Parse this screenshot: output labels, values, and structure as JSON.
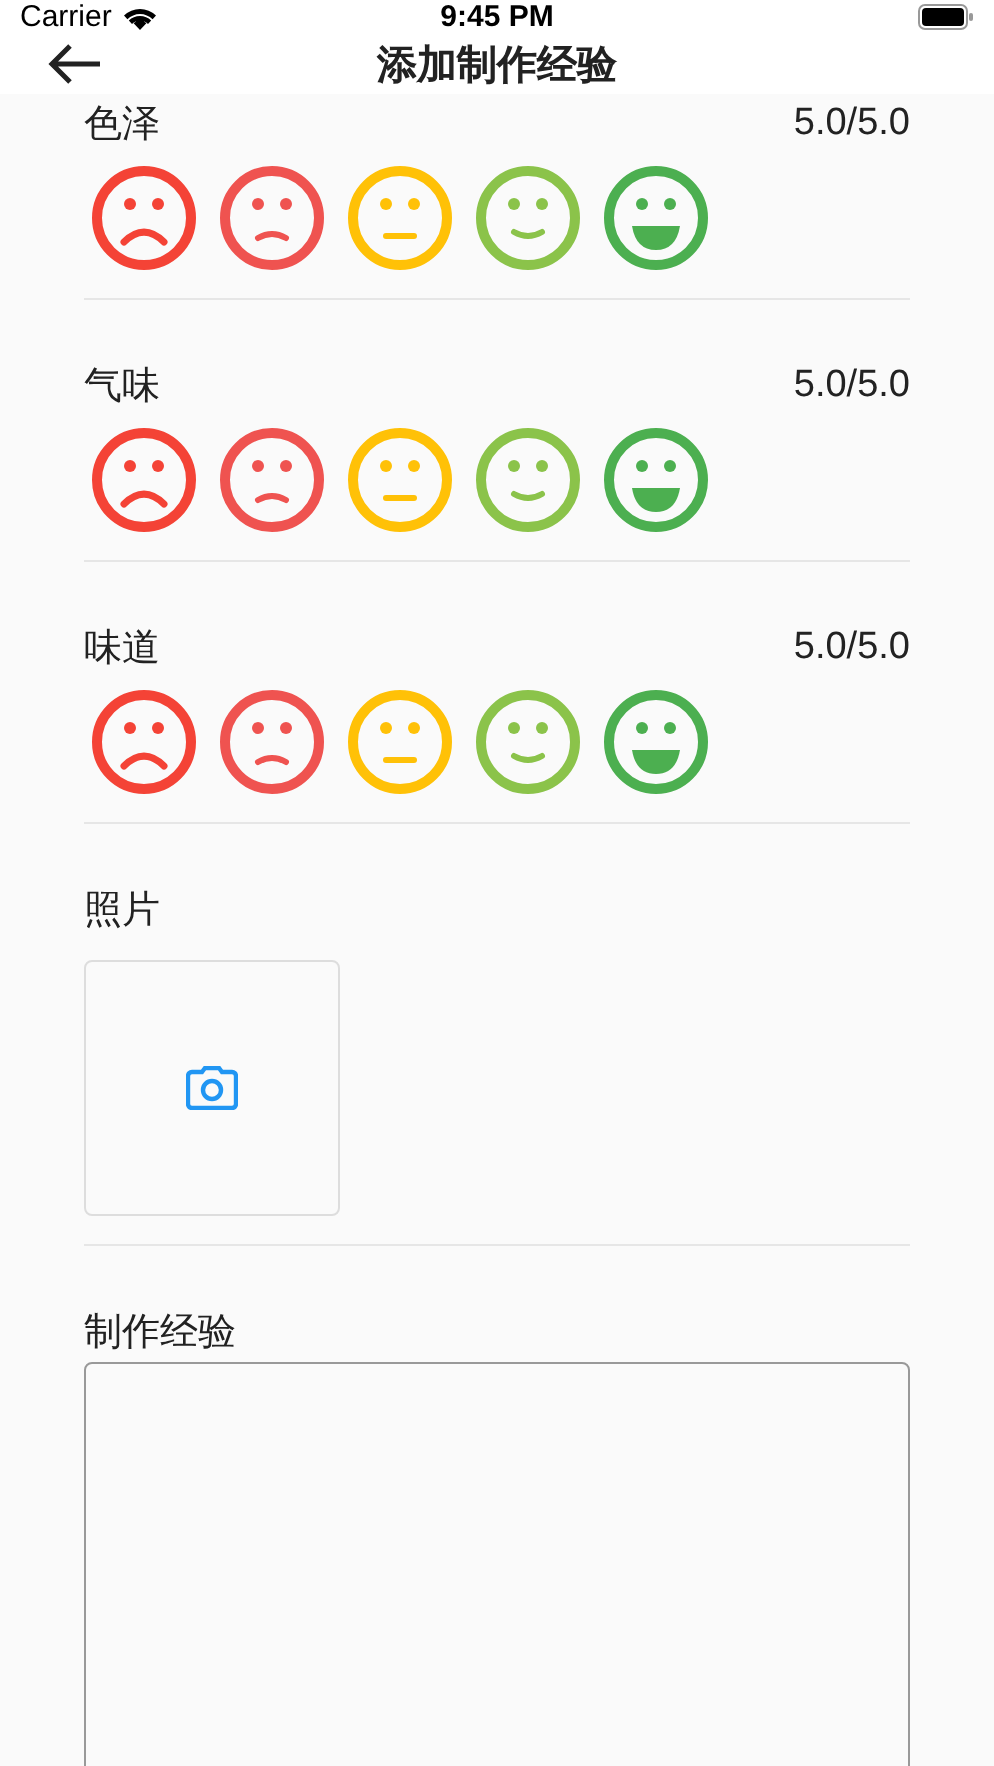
{
  "status_bar": {
    "carrier": "Carrier",
    "time": "9:45 PM"
  },
  "header": {
    "title": "添加制作经验"
  },
  "ratings": [
    {
      "label": "色泽",
      "reading": "5.0/5.0"
    },
    {
      "label": "气味",
      "reading": "5.0/5.0"
    },
    {
      "label": "味道",
      "reading": "5.0/5.0"
    }
  ],
  "photos": {
    "label": "照片"
  },
  "experience": {
    "label": "制作经验"
  }
}
